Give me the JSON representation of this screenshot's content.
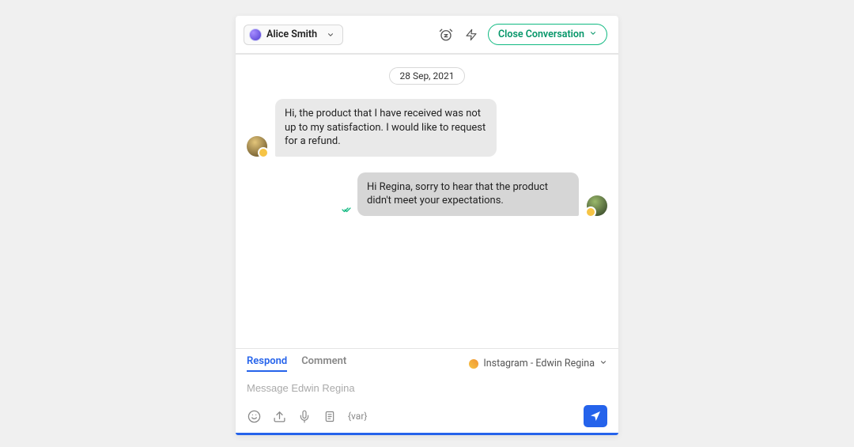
{
  "header": {
    "assignee_name": "Alice Smith",
    "close_label": "Close Conversation"
  },
  "conversation": {
    "date_label": "28 Sep, 2021",
    "messages": [
      {
        "direction": "incoming",
        "text": "Hi, the product that I have received was not up to my satisfaction. I would like to request for a refund."
      },
      {
        "direction": "outgoing",
        "text": "Hi Regina, sorry to hear that the product didn't meet your expectations."
      }
    ]
  },
  "composer": {
    "tabs": {
      "respond": "Respond",
      "comment": "Comment"
    },
    "channel_label": "Instagram - Edwin Regina",
    "placeholder": "Message Edwin Regina",
    "var_label": "{var}"
  }
}
